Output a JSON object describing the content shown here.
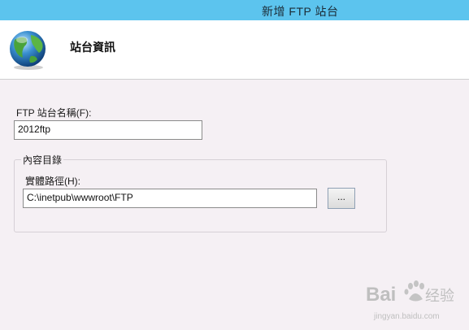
{
  "window": {
    "title": "新增 FTP 站台"
  },
  "header": {
    "heading": "站台資訊",
    "icon": "globe-icon"
  },
  "site_name": {
    "label": "FTP 站台名稱(F):",
    "value": "2012ftp"
  },
  "content_directory": {
    "group_title": "內容目錄",
    "physical_path_label": "實體路徑(H):",
    "physical_path_value": "C:\\inetpub\\wwwroot\\FTP",
    "browse_label": "..."
  },
  "watermark": {
    "brand": "Bai",
    "brand_cn": "经验",
    "url": "jingyan.baidu.com"
  },
  "colors": {
    "titlebar": "#5cc4ee",
    "background": "#f5f0f4",
    "header": "#ffffff"
  }
}
